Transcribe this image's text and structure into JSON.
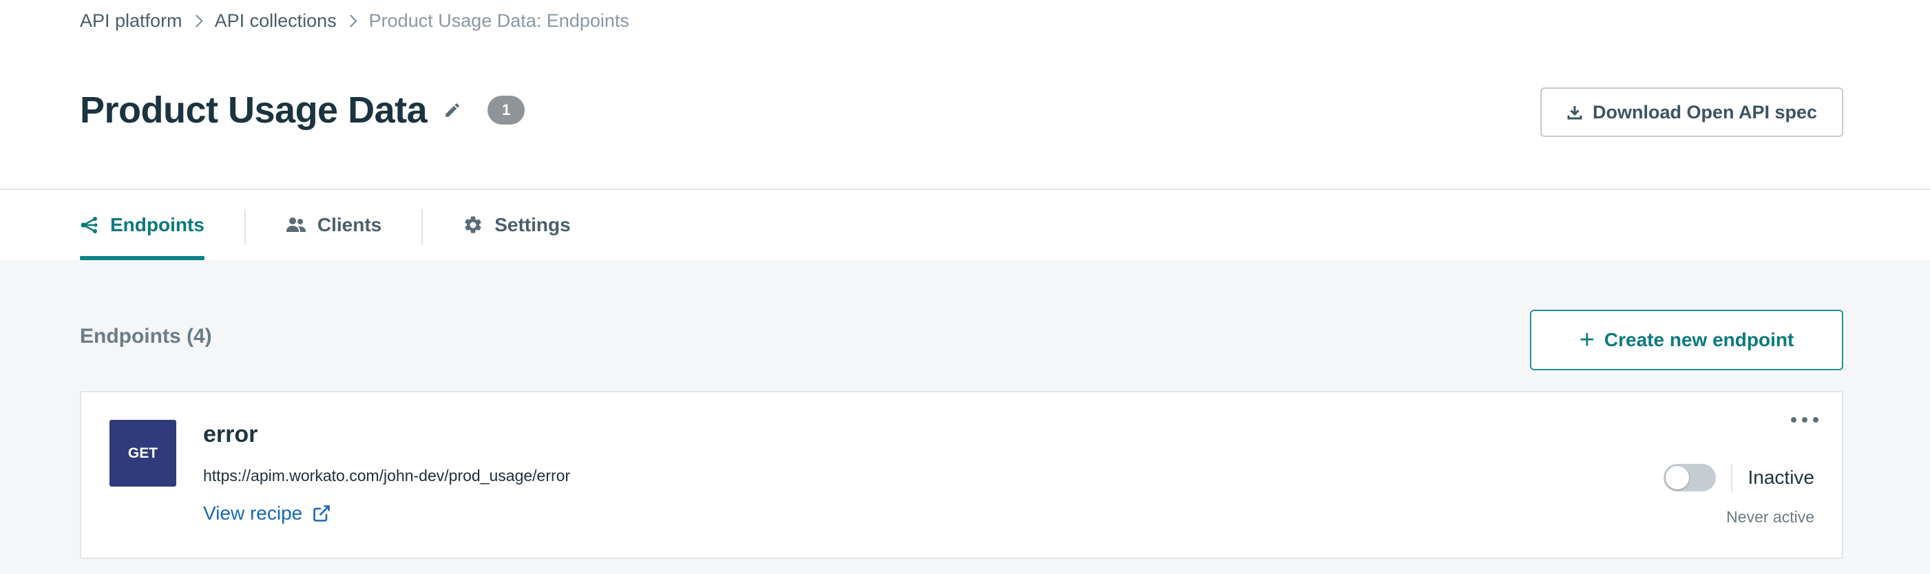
{
  "breadcrumb": {
    "items": [
      {
        "label": "API platform"
      },
      {
        "label": "API collections"
      },
      {
        "label": "Product Usage Data: Endpoints"
      }
    ]
  },
  "header": {
    "title": "Product Usage Data",
    "version_badge": "1",
    "download_button": "Download Open API spec"
  },
  "tabs": [
    {
      "label": "Endpoints",
      "icon": "endpoints-icon",
      "active": true
    },
    {
      "label": "Clients",
      "icon": "users-icon",
      "active": false
    },
    {
      "label": "Settings",
      "icon": "gear-icon",
      "active": false
    }
  ],
  "endpoints_section": {
    "title": "Endpoints (4)",
    "create_button": "Create new endpoint",
    "create_icon": "+",
    "items": [
      {
        "method": "GET",
        "name": "error",
        "url": "https://apim.workato.com/john-dev/prod_usage/error",
        "link_label": "View recipe",
        "toggle_on": false,
        "status": "Inactive",
        "status_sub": "Never active"
      }
    ]
  },
  "colors": {
    "accent": "#0a8287",
    "method_get": "#2f3b7a",
    "link": "#1568b8",
    "badge": "#8f9499"
  }
}
